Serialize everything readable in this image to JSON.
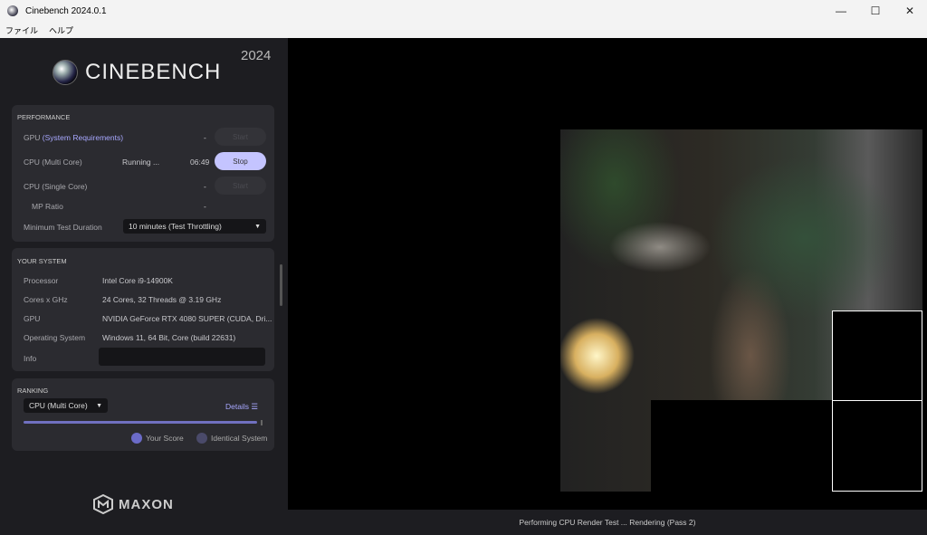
{
  "window": {
    "title": "Cinebench 2024.0.1",
    "minimize": "—",
    "maximize": "☐",
    "close": "✕"
  },
  "menu": [
    "ファイル",
    "ヘルプ"
  ],
  "logo": {
    "text": "CINEBENCH",
    "year": "2024"
  },
  "performance": {
    "heading": "PERFORMANCE",
    "gpu": {
      "label": "GPU",
      "link": "(System Requirements)",
      "value": "-",
      "button": "Start"
    },
    "cpu_multi": {
      "label": "CPU (Multi Core)",
      "status": "Running ...",
      "time": "06:49",
      "button": "Stop"
    },
    "cpu_single": {
      "label": "CPU (Single Core)",
      "value": "-",
      "button": "Start"
    },
    "mp_ratio": {
      "label": "MP Ratio",
      "value": "-"
    },
    "min_duration": {
      "label": "Minimum Test Duration",
      "value": "10 minutes (Test Throttling)"
    }
  },
  "system": {
    "heading": "YOUR SYSTEM",
    "rows": [
      {
        "label": "Processor",
        "value": "Intel Core i9-14900K"
      },
      {
        "label": "Cores x GHz",
        "value": "24 Cores, 32 Threads @ 3.19 GHz"
      },
      {
        "label": "GPU",
        "value": "NVIDIA GeForce RTX 4080 SUPER (CUDA, Dri..."
      },
      {
        "label": "Operating System",
        "value": "Windows 11, 64 Bit, Core (build 22631)"
      }
    ],
    "info_label": "Info",
    "info_value": ""
  },
  "ranking": {
    "heading": "RANKING",
    "select": "CPU (Multi Core)",
    "details": "Details",
    "legend": [
      "Your Score",
      "Identical System"
    ],
    "colors": {
      "your": "#6b6bc8",
      "identical": "#4a4a6a"
    }
  },
  "brand": "MAXON",
  "status": "Performing CPU Render Test ... Rendering (Pass 2)"
}
